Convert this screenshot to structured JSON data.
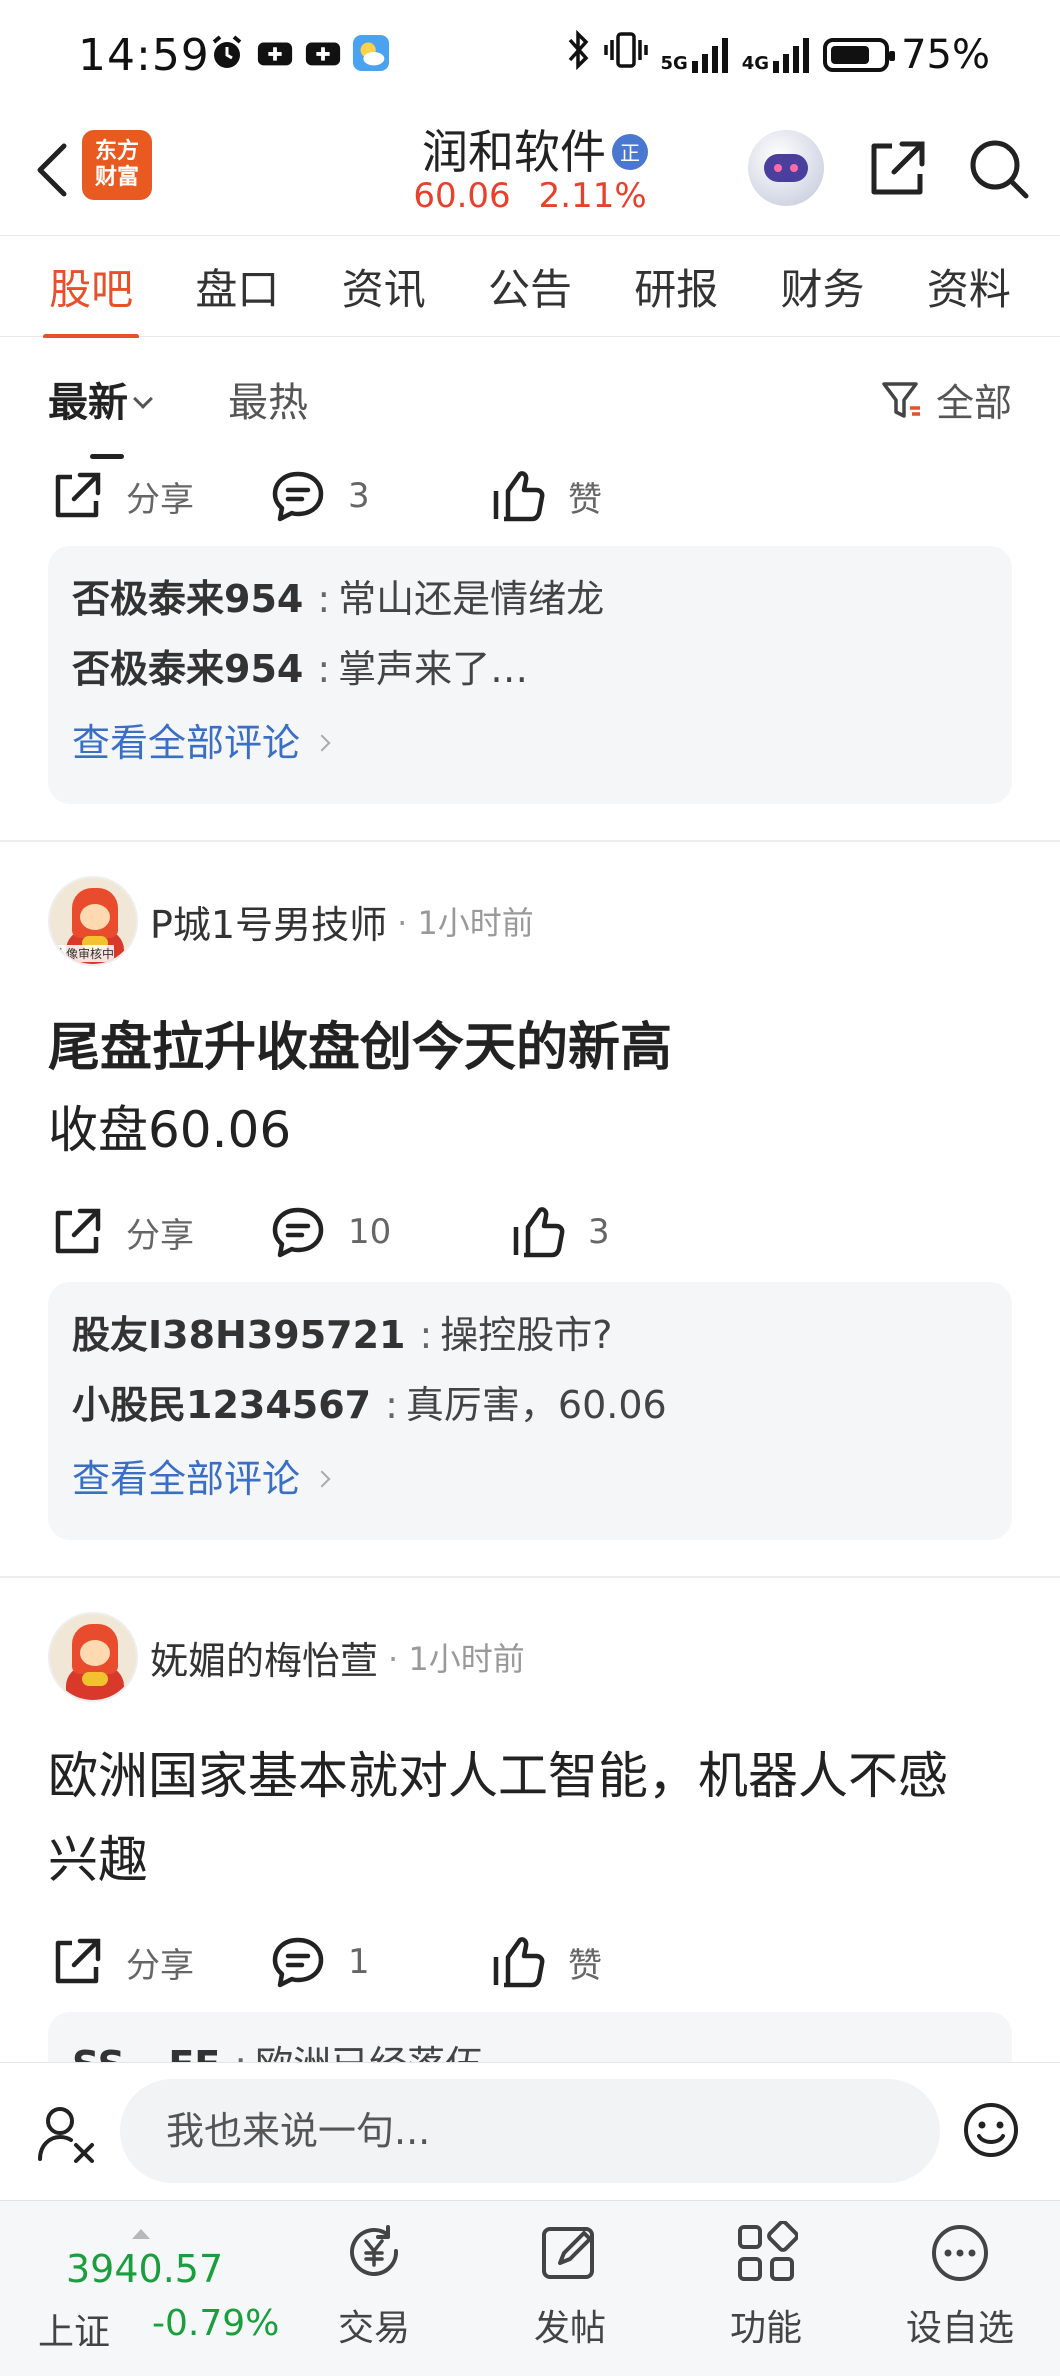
{
  "status_bar": {
    "time": "14:59",
    "network_5g": "5G",
    "network_4g": "4G",
    "battery_percent": "75%",
    "battery_level": 0.75
  },
  "header": {
    "app_logo_line1": "东方",
    "app_logo_line2": "财富",
    "stock_name": "润和软件",
    "badge": "正",
    "price": "60.06",
    "change_pct": "2.11%",
    "accent_color": "#e8502c"
  },
  "tabs": [
    {
      "label": "股吧",
      "active": true
    },
    {
      "label": "盘口",
      "active": false
    },
    {
      "label": "资讯",
      "active": false
    },
    {
      "label": "公告",
      "active": false
    },
    {
      "label": "研报",
      "active": false
    },
    {
      "label": "财务",
      "active": false
    },
    {
      "label": "资料",
      "active": false
    }
  ],
  "sort": {
    "latest": "最新",
    "hot": "最热",
    "filter": "全部"
  },
  "feed": {
    "share_label": "分享",
    "like_label": "赞",
    "view_all_comments": "查看全部评论",
    "avatar_review_tag": "头像审核中",
    "post0": {
      "comment_count": "3",
      "like_text": "赞",
      "comments": [
        {
          "user": "否极泰来954",
          "text": "常山还是情绪龙"
        },
        {
          "user": "否极泰来954",
          "text": "掌声来了…"
        }
      ]
    },
    "post1": {
      "author": "P城1号男技师",
      "time": "1小时前",
      "title": "尾盘拉升收盘创今天的新高",
      "body": "收盘60.06",
      "comment_count": "10",
      "like_text": "3",
      "comments": [
        {
          "user": "股友I38H395721",
          "text": "操控股市?"
        },
        {
          "user": "小股民1234567",
          "text": "真厉害，60.06"
        }
      ]
    },
    "post2": {
      "author": "妩媚的梅怡萱",
      "time": "1小时前",
      "body_line1": "欧洲国家基本就对人工智能，机器人不感",
      "body_line2": "兴趣",
      "comment_count": "1",
      "like_text": "赞",
      "comments": [
        {
          "user": "SS...EE",
          "text": "欧洲已经落伍"
        }
      ]
    }
  },
  "input_bar": {
    "placeholder": "我也来说一句..."
  },
  "bottom_nav": {
    "index_value": "3940.57",
    "index_name": "上证",
    "index_change": "-0.79%",
    "items": [
      {
        "label": "交易",
        "icon": "yuan-cycle-icon"
      },
      {
        "label": "发帖",
        "icon": "edit-icon"
      },
      {
        "label": "功能",
        "icon": "grid-icon"
      },
      {
        "label": "设自选",
        "icon": "more-icon"
      }
    ]
  }
}
